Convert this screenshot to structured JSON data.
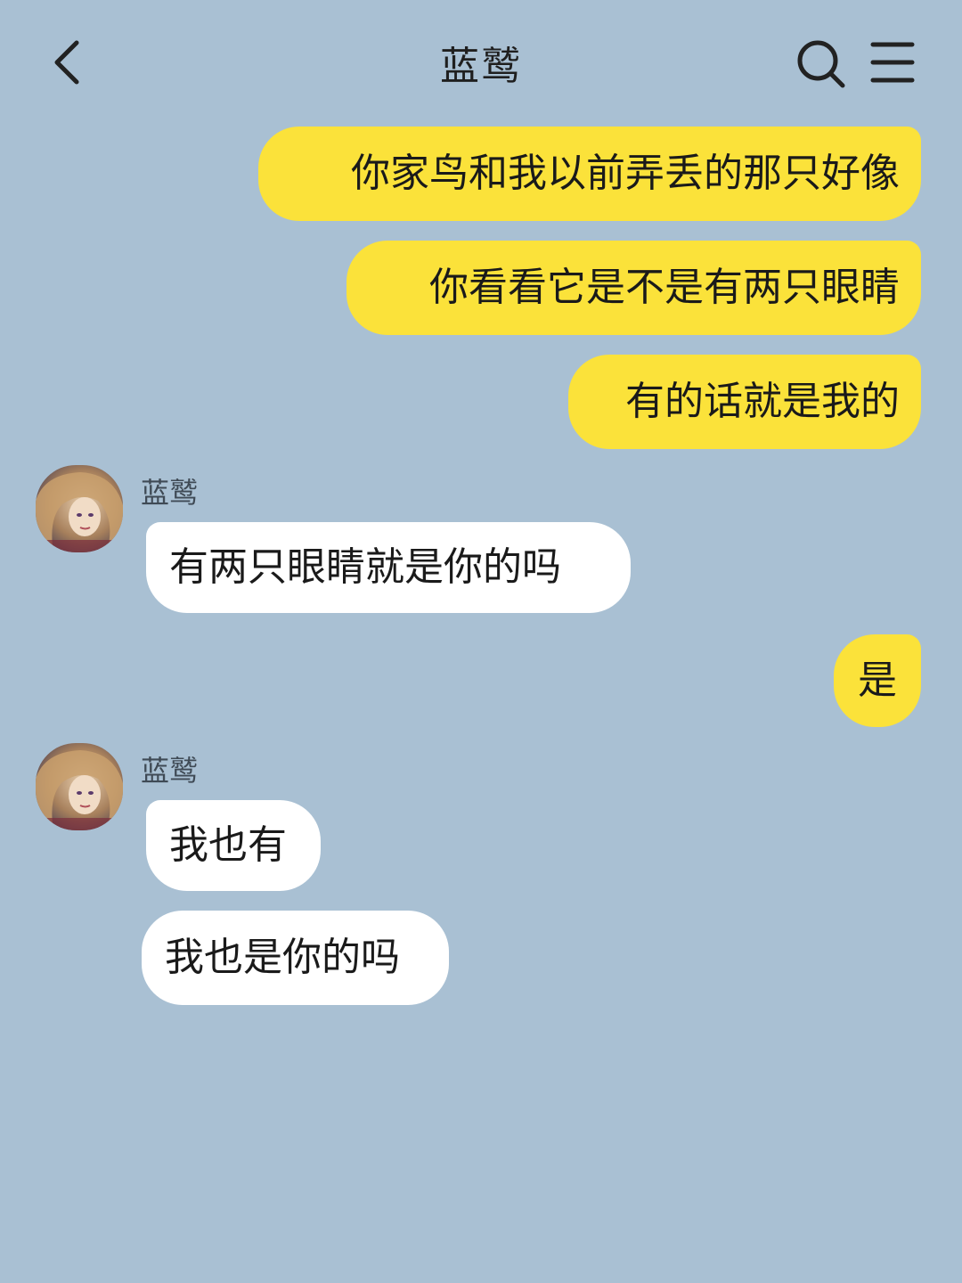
{
  "header": {
    "title": "蓝鹫",
    "back_icon": "chevron-left-icon",
    "search_icon": "search-icon",
    "menu_icon": "menu-icon"
  },
  "colors": {
    "background": "#a9c0d3",
    "outgoing_bubble": "#fbe23a",
    "incoming_bubble": "#ffffff"
  },
  "messages": [
    {
      "from": "me",
      "text": "你家鸟和我以前弄丢的那只好像"
    },
    {
      "from": "me",
      "text": "你看看它是不是有两只眼睛"
    },
    {
      "from": "me",
      "text": "有的话就是我的"
    },
    {
      "from": "contact",
      "sender": "蓝鹫",
      "text": "有两只眼睛就是你的吗"
    },
    {
      "from": "me",
      "text": "是"
    },
    {
      "from": "contact",
      "sender": "蓝鹫",
      "text": "我也有"
    },
    {
      "from": "contact",
      "text": "我也是你的吗"
    }
  ]
}
